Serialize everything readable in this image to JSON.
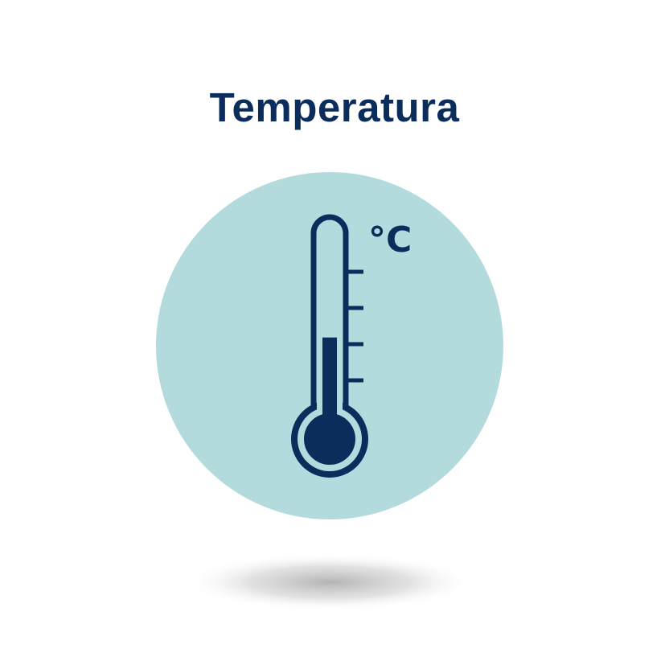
{
  "title": "Temperatura",
  "thermometer": {
    "unit": "°C",
    "fill_level": 0.45
  },
  "icons": {
    "main": "thermometer-icon"
  },
  "colors": {
    "ink": "#0b2d5c",
    "circle": "#b3dbdd",
    "background": "#ffffff",
    "shadow": "#9a9a9a"
  }
}
